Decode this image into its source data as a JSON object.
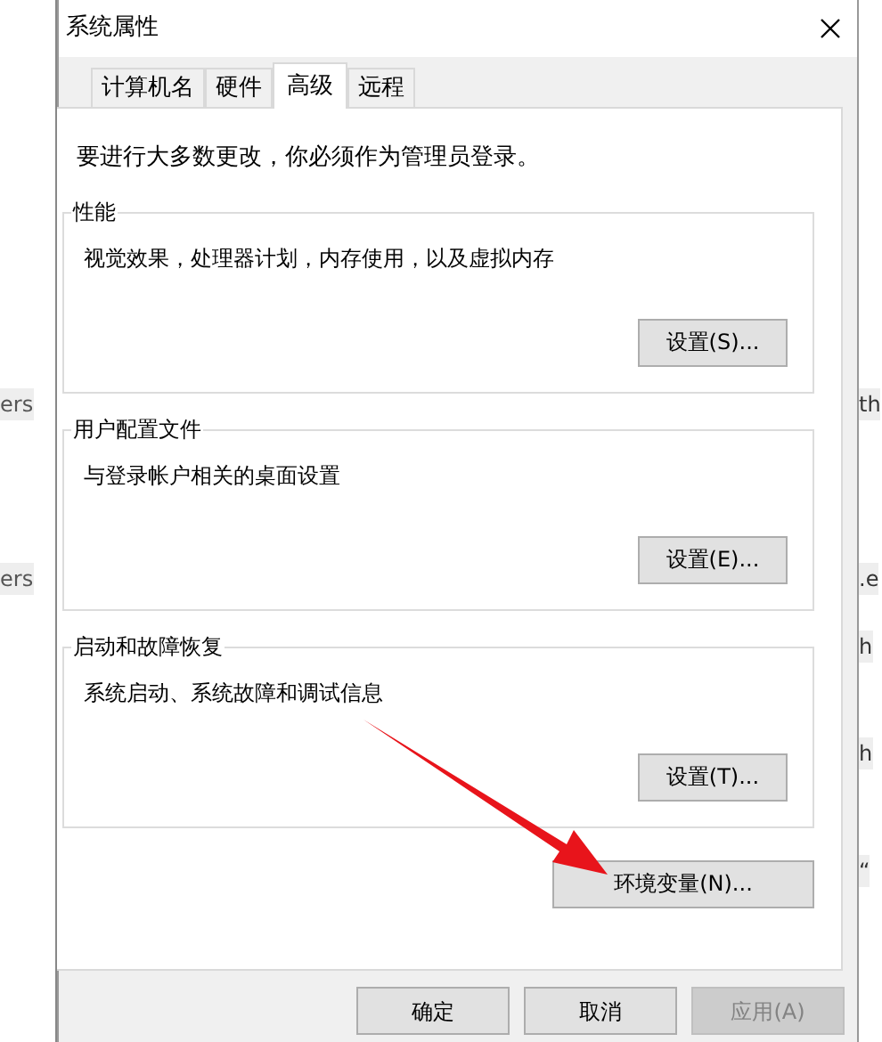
{
  "background": {
    "left_fragments": [
      "ers",
      "ers"
    ],
    "right_fragments": [
      "th",
      ".e",
      "h",
      "h",
      "“"
    ]
  },
  "window": {
    "title": "系统属性"
  },
  "tabs": [
    {
      "label": "计算机名",
      "selected": false
    },
    {
      "label": "硬件",
      "selected": false
    },
    {
      "label": "高级",
      "selected": true
    },
    {
      "label": "远程",
      "selected": false
    }
  ],
  "notice": "要进行大多数更改，你必须作为管理员登录。",
  "groups": [
    {
      "title": "性能",
      "description": "视觉效果，处理器计划，内存使用，以及虚拟内存",
      "button": "设置(S)..."
    },
    {
      "title": "用户配置文件",
      "description": "与登录帐户相关的桌面设置",
      "button": "设置(E)..."
    },
    {
      "title": "启动和故障恢复",
      "description": "系统启动、系统故障和调试信息",
      "button": "设置(T)..."
    }
  ],
  "env_button": "环境变量(N)...",
  "buttons": [
    {
      "label": "确定",
      "disabled": false
    },
    {
      "label": "取消",
      "disabled": false
    },
    {
      "label": "应用(A)",
      "disabled": true
    }
  ]
}
